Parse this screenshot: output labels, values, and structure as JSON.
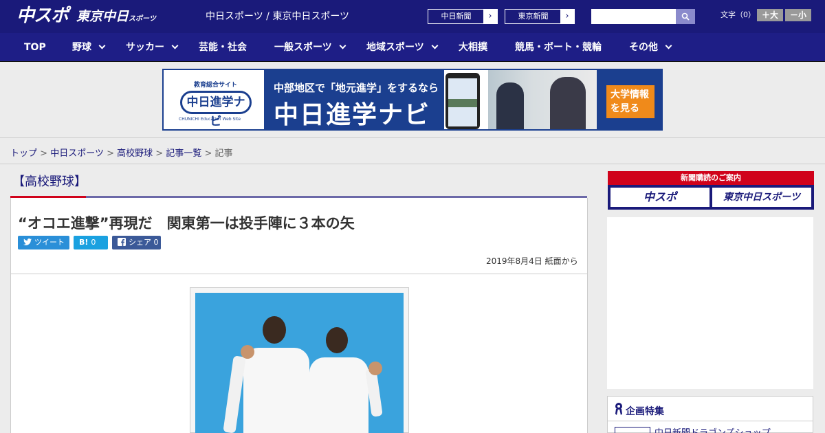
{
  "header": {
    "logo_chuspo": "中スポ",
    "logo_tokyo": "東京中日",
    "logo_tokyo_small": "スポーツ",
    "site_title": "中日スポーツ / 東京中日スポーツ",
    "paper_buttons": [
      {
        "label": "中日新聞",
        "arrow": "›"
      },
      {
        "label": "東京新聞",
        "arrow": "›"
      }
    ],
    "search": {
      "placeholder": "",
      "icon": "search-icon"
    },
    "text_size": {
      "label": "文字（0）",
      "larger": "＋大",
      "smaller": "－小"
    }
  },
  "nav": {
    "items": [
      {
        "label": "TOP",
        "dropdown": false
      },
      {
        "label": "野球",
        "dropdown": true
      },
      {
        "label": "サッカー",
        "dropdown": true
      },
      {
        "label": "芸能・社会",
        "dropdown": false
      },
      {
        "label": "一般スポーツ",
        "dropdown": true
      },
      {
        "label": "地域スポーツ",
        "dropdown": true
      },
      {
        "label": "大相撲",
        "dropdown": false
      },
      {
        "label": "競馬・ボート・競輪",
        "dropdown": false
      },
      {
        "label": "その他",
        "dropdown": true
      }
    ]
  },
  "banner": {
    "logo_small": "教育総合サイト",
    "logo_name": "中日進学ナビ",
    "logo_sub": "CHUNICHI Education Web Site",
    "line1": "中部地区で「地元進学」をするなら",
    "line2": "中日進学ナビ",
    "cta": "大学情報を見る"
  },
  "breadcrumb": {
    "items": [
      "トップ",
      "中日スポーツ",
      "高校野球",
      "記事一覧"
    ],
    "current": "記事",
    "separator": ">"
  },
  "article": {
    "category": "【高校野球】",
    "headline": "“オコエ進撃”再現だ　関東第一は投手陣に３本の矢",
    "share": {
      "tweet": "ツイート",
      "hatena_icon": "B!",
      "hatena_count": "0",
      "facebook_label": "シェア",
      "facebook_count": "0"
    },
    "date": "2019年8月4日 紙面から"
  },
  "sidebar": {
    "subscribe_header": "新聞購読のご案内",
    "subscribe_buttons": [
      "中スポ",
      "東京中日スポーツ"
    ],
    "feature_title": "企画特集",
    "feature_item": "中日新聞ドラゴンズショップ"
  },
  "colors": {
    "brand_navy": "#1a1a7a",
    "accent_red": "#d0021b",
    "twitter": "#2a8fd8",
    "hatena": "#1aa1e0",
    "facebook": "#3b5998"
  }
}
